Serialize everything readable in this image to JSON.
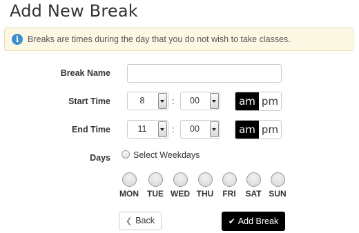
{
  "page": {
    "title": "Add New Break"
  },
  "alert": {
    "text": "Breaks are times during the day that you do not wish to take classes."
  },
  "form": {
    "break_name": {
      "label": "Break Name",
      "value": "",
      "placeholder": ""
    },
    "start_time": {
      "label": "Start Time",
      "hour": "8",
      "minute": "00",
      "separator": ":",
      "am_label": "am",
      "pm_label": "pm",
      "selected_period": "am"
    },
    "end_time": {
      "label": "End Time",
      "hour": "11",
      "minute": "00",
      "separator": ":",
      "am_label": "am",
      "pm_label": "pm",
      "selected_period": "am"
    },
    "days": {
      "label": "Days",
      "select_weekdays_label": "Select Weekdays",
      "items": [
        {
          "label": "MON",
          "selected": false
        },
        {
          "label": "TUE",
          "selected": false
        },
        {
          "label": "WED",
          "selected": false
        },
        {
          "label": "THU",
          "selected": false
        },
        {
          "label": "FRI",
          "selected": false
        },
        {
          "label": "SAT",
          "selected": false
        },
        {
          "label": "SUN",
          "selected": false
        }
      ]
    }
  },
  "buttons": {
    "back_label": "Back",
    "back_icon": "chevron-left-icon",
    "add_label": "Add Break",
    "add_icon": "check-icon"
  },
  "colors": {
    "alert_bg": "#fcf8e3",
    "info_icon": "#3b8ed0",
    "primary": "#000000"
  }
}
